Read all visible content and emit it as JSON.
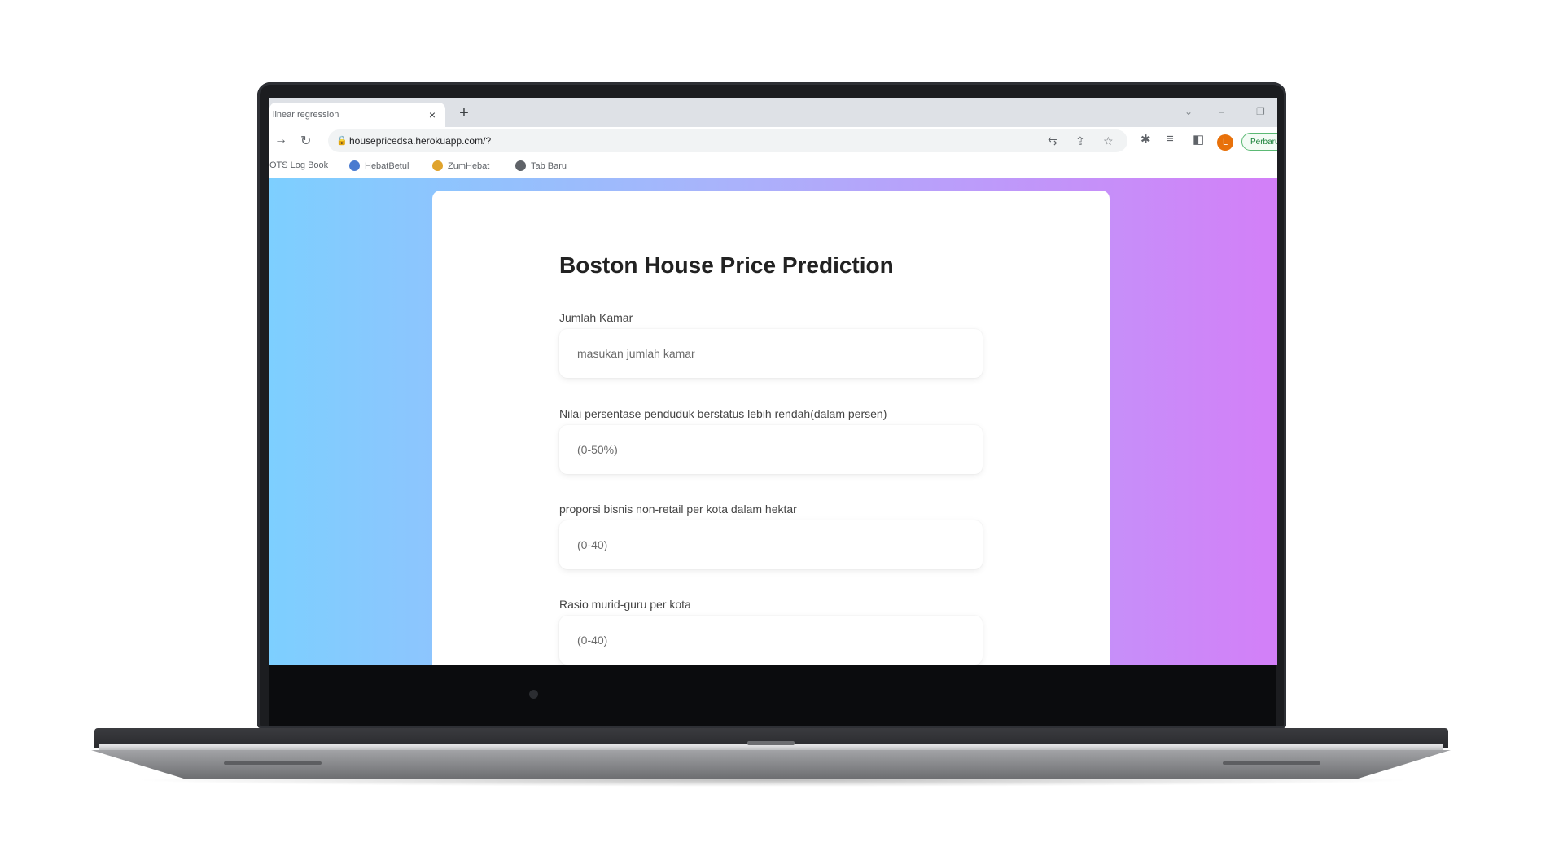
{
  "browser": {
    "tab": {
      "title": "linear regression",
      "close_label": "×"
    },
    "new_tab_label": "+",
    "window_controls": {
      "dropdown": "⌄",
      "minimize": "–",
      "restore": "❐"
    },
    "address": {
      "url": "housepricedsa.herokuapp.com/?"
    },
    "avatar_letter": "L",
    "update_label": "Perbarui",
    "bookmarks": [
      {
        "label": "OTS Log Book"
      },
      {
        "label": "HebatBetul"
      },
      {
        "label": "ZumHebat"
      },
      {
        "label": "Tab Baru"
      }
    ]
  },
  "page": {
    "title": "Boston House Price Prediction",
    "fields": [
      {
        "label": "Jumlah Kamar",
        "placeholder": "masukan jumlah kamar"
      },
      {
        "label": "Nilai persentase penduduk berstatus lebih rendah(dalam persen)",
        "placeholder": "(0-50%)"
      },
      {
        "label": "proporsi bisnis non-retail per kota dalam hektar",
        "placeholder": "(0-40)"
      },
      {
        "label": "Rasio murid-guru per kota",
        "placeholder": "(0-40)"
      }
    ]
  },
  "colors": {
    "gradient_left": "#7dcfff",
    "gradient_right": "#d37ff8",
    "avatar": "#e8710a"
  }
}
